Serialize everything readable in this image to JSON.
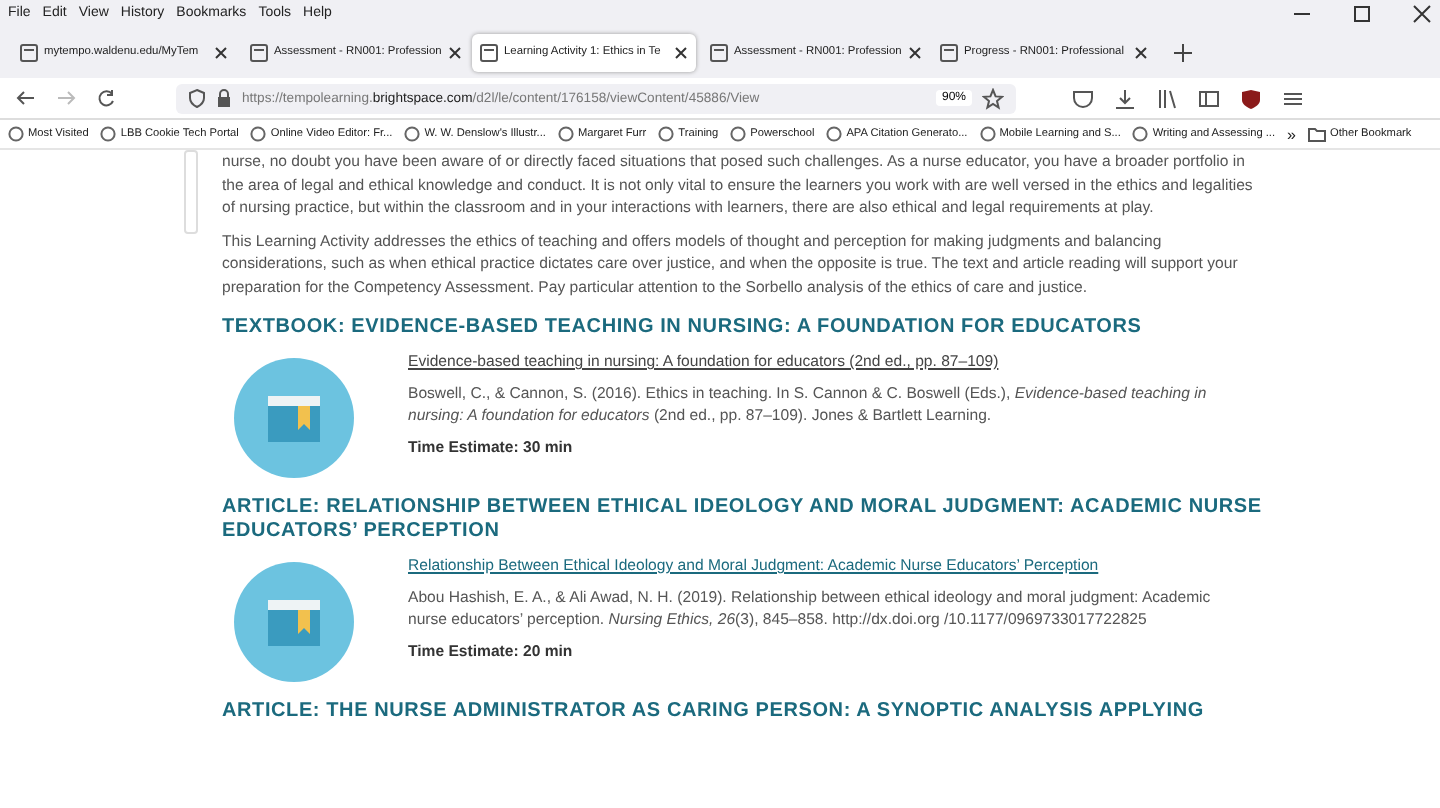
{
  "menu": [
    "File",
    "Edit",
    "View",
    "History",
    "Bookmarks",
    "Tools",
    "Help"
  ],
  "tabs": [
    {
      "title": "mytempo.waldenu.edu/MyTem",
      "selected": false
    },
    {
      "title": "Assessment - RN001: Profession",
      "selected": false
    },
    {
      "title": "Learning Activity 1: Ethics in Te",
      "selected": true
    },
    {
      "title": "Assessment - RN001: Profession",
      "selected": false
    },
    {
      "title": "Progress - RN001: Professional",
      "selected": false
    }
  ],
  "address": {
    "prefix": "https://tempolearning.",
    "domain": "brightspace.com",
    "path": "/d2l/le/content/176158/viewContent/45886/View",
    "zoom": "90%"
  },
  "bookmarks": [
    "Most Visited",
    "LBB Cookie Tech Portal",
    "Online Video Editor: Fr...",
    "W. W. Denslow's Illustr...",
    "Margaret Furr",
    "Training",
    "Powerschool",
    "APA Citation Generato...",
    "Mobile Learning and S...",
    "Writing and Assessing ..."
  ],
  "bookmarks_more": "»",
  "other_bookmarks": "Other Bookmark",
  "paragraphs": [
    "nurse, no doubt you have been aware of or directly faced situations that posed such challenges. As a nurse educator, you have a broader portfolio in the area of legal and ethical knowledge and conduct. It is not only vital to ensure the learners you work with are well versed in the ethics and legalities of nursing practice, but within the classroom and in your interactions with learners, there are also ethical and legal requirements at play.",
    "This Learning Activity addresses the ethics of teaching and offers models of thought and perception for making judgments and balancing considerations, such as when ethical practice dictates care over justice, and when the opposite is true. The text and article reading will support your preparation for the Competency Assessment. Pay particular attention to the Sorbello analysis of the ethics of care and justice."
  ],
  "resources": [
    {
      "heading": "TEXTBOOK: EVIDENCE-BASED TEACHING IN NURSING: A FOUNDATION FOR EDUCATORS",
      "link": "Evidence-based teaching in nursing: A foundation for educators (2nd ed., pp. 87–109)",
      "citation": "Boswell, C., & Cannon, S. (2016). Ethics in teaching. In S. Cannon & C. Boswell (Eds.), *Evidence-based teaching in nursing: A foundation for educators* (2nd ed., pp. 87–109). Jones & Bartlett Learning.",
      "time": "Time Estimate: 30 min"
    },
    {
      "heading": "ARTICLE: RELATIONSHIP BETWEEN ETHICAL IDEOLOGY AND MORAL JUDGMENT: ACADEMIC NURSE EDUCATORS’ PERCEPTION",
      "link": "Relationship Between Ethical Ideology and Moral Judgment: Academic Nurse Educators’ Perception",
      "citation": "Abou Hashish, E. A., & Ali Awad, N. H. (2019). Relationship between ethical ideology and moral judgment: Academic nurse educators’ perception. *Nursing Ethics, 26*(3), 845–858. http://dx.doi.org /10.1177/0969733017722825",
      "time": "Time Estimate: 20 min"
    }
  ],
  "next_heading": "ARTICLE: THE NURSE ADMINISTRATOR AS CARING PERSON: A SYNOPTIC ANALYSIS APPLYING"
}
